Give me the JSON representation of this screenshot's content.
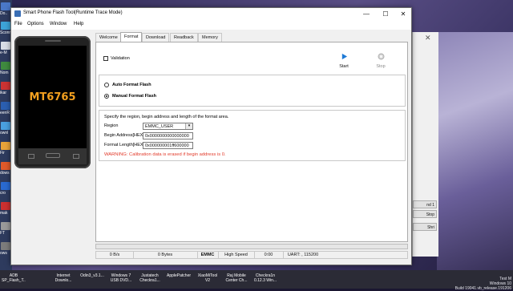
{
  "window": {
    "title": "Smart Phone Flash Tool(Runtime Trace Mode)",
    "minimize": "—",
    "maximize": "☐",
    "close": "✕"
  },
  "menu": [
    "File",
    "Options",
    "Window",
    "Help"
  ],
  "device": {
    "chip": "MT6765"
  },
  "tabs": [
    "Welcome",
    "Format",
    "Download",
    "Readback",
    "Memory Test"
  ],
  "active_tab": "Format",
  "format": {
    "validation_label": "Validation",
    "start_label": "Start",
    "stop_label": "Stop",
    "auto_label": "Auto Format Flash",
    "manual_label": "Manual Format Flash",
    "instruction": "Specify the region, begin address and length of the format area.",
    "region_label": "Region",
    "region_value": "EMMC_USER",
    "begin_label": "Begin Address[HEX]:",
    "begin_value": "0x0000000000000000",
    "length_label": "Format Length[HEX]:",
    "length_value": "0x000000001ff600000",
    "warning": "WARNING: Calibration data is erased if begin address is 0."
  },
  "status": {
    "speed_rate": "0 B/s",
    "bytes": "0 Bytes",
    "storage": "EMMC",
    "usb_speed": "High Speed",
    "time": "0:00",
    "port": "UART: , 115200"
  },
  "taskbar": [
    "ADB SP_Flash_T...",
    "Internet Downlo...",
    "Odin3_v3.1...",
    "Windows 7 USB DVD...",
    "Justatech Checkra1...",
    "ApplePatcher",
    "XiaoMiTool V2",
    "Raj Mobile Center Ch...",
    "Checkra1n 0.12.3 Win..."
  ],
  "desktop_icons": [
    "Do..",
    "Sconn",
    "e-M",
    "Nom",
    "ikar",
    "eenR",
    "ownl",
    "Fir",
    "dows",
    "cro",
    "mak",
    "FT",
    "ows"
  ],
  "ghost_buttons": [
    "nd 1",
    "Stop",
    "Shri"
  ],
  "build_text": [
    "Test M",
    "Windows 10",
    "Build 19041.vb_release.191206"
  ],
  "colors": {
    "chip_text": "#f3a01f",
    "warning": "#e23a2a",
    "start_icon": "#1e7ad6"
  }
}
